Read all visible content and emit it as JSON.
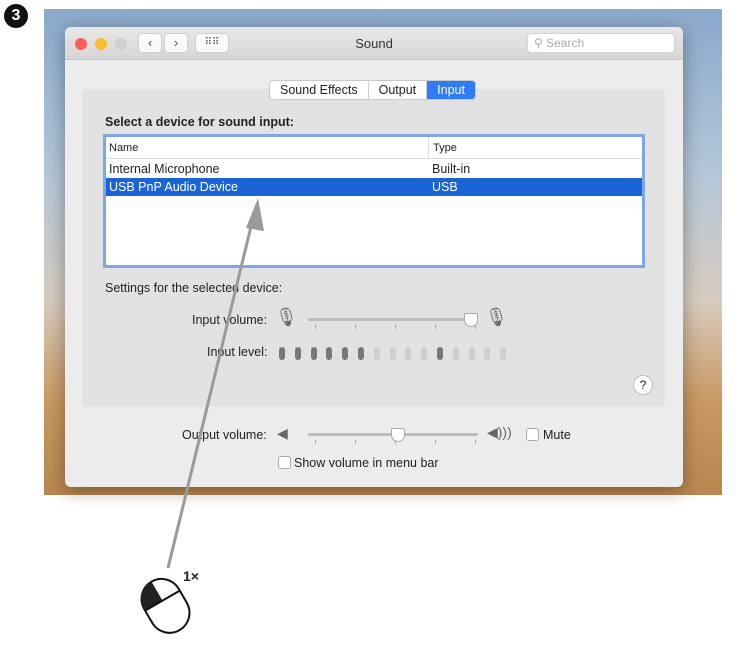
{
  "step_number": "3",
  "window": {
    "title": "Sound",
    "search_placeholder": "Search"
  },
  "tabs": [
    {
      "label": "Sound Effects"
    },
    {
      "label": "Output"
    },
    {
      "label": "Input",
      "active": true
    }
  ],
  "input": {
    "heading": "Select a device for sound input:",
    "columns": [
      "Name",
      "Type"
    ],
    "devices": [
      {
        "name": "Internal Microphone",
        "type": "Built-in"
      },
      {
        "name": "USB PnP Audio Device",
        "type": "USB",
        "selected": true
      }
    ],
    "settings_heading": "Settings for the selected device:",
    "input_volume_label": "Input volume:",
    "input_volume": 0.96,
    "input_level_label": "Input level:",
    "input_level_bars": [
      1,
      1,
      1,
      1,
      1,
      1,
      0,
      0,
      0,
      0,
      1,
      0,
      0,
      0,
      0
    ]
  },
  "output_volume_label": "Output volume:",
  "output_volume": 0.53,
  "mute_label": "Mute",
  "show_volume_label": "Show volume in menu bar",
  "help_label": "?",
  "click_count": "1×",
  "colors": {
    "accent": "#2f7cf6",
    "selection": "#1a64d6"
  }
}
